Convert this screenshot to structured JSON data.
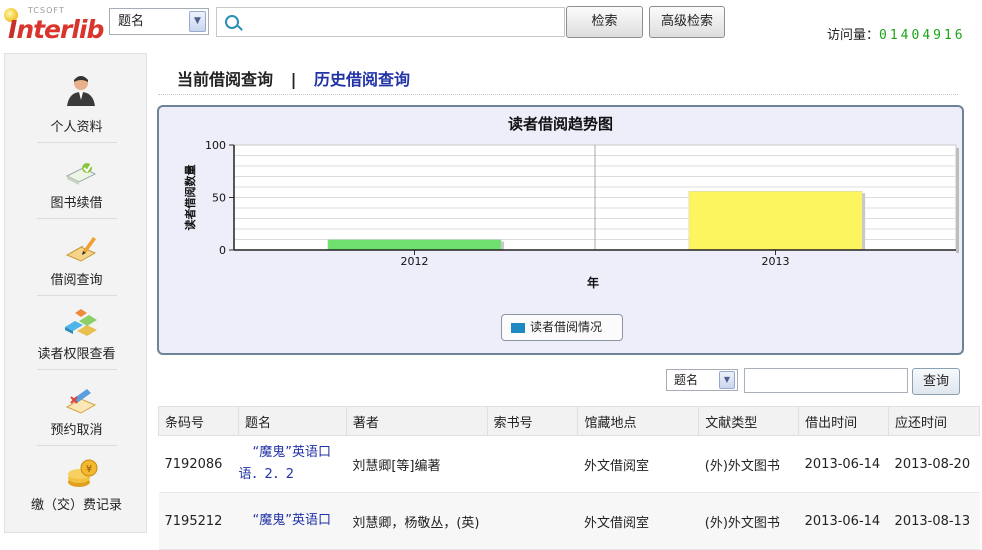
{
  "header": {
    "logo_small": "TCSOFT",
    "logo_main": "nterlib",
    "logo_prefix": "I",
    "search_field_select": "题名",
    "search_value": "",
    "search_button": "检索",
    "advanced_button": "高级检索",
    "visits_label": "访问量：",
    "visits_count": "01404916"
  },
  "sidebar": {
    "items": [
      {
        "label": "个人资料",
        "icon": "user-avatar-icon"
      },
      {
        "label": "图书续借",
        "icon": "book-renew-icon"
      },
      {
        "label": "借阅查询",
        "icon": "borrow-query-icon"
      },
      {
        "label": "读者权限查看",
        "icon": "reader-permission-icon"
      },
      {
        "label": "预约取消",
        "icon": "reservation-cancel-icon"
      },
      {
        "label": "缴（交）费记录",
        "icon": "fee-record-icon"
      }
    ]
  },
  "tabs": {
    "current": "当前借阅查询",
    "separator": "|",
    "history": "历史借阅查询"
  },
  "chart_data": {
    "type": "bar",
    "title": "读者借阅趋势图",
    "xlabel": "年",
    "ylabel": "读者借阅数量",
    "categories": [
      "2012",
      "2013"
    ],
    "series": [
      {
        "name": "读者借阅情况",
        "values": [
          10,
          56
        ]
      }
    ],
    "bar_colors": [
      "#6de06d",
      "#fdf560"
    ],
    "ylim": [
      0,
      100
    ],
    "yticks": [
      "0",
      "50",
      "100"
    ],
    "grid": true,
    "legend_position": "bottom-center",
    "legend_color": "#1f8ac2"
  },
  "filter": {
    "select": "题名",
    "input_value": "",
    "button": "查询"
  },
  "table": {
    "headers": [
      "条码号",
      "题名",
      "著者",
      "索书号",
      "馆藏地点",
      "文献类型",
      "借出时间",
      "应还时间"
    ],
    "rows": [
      {
        "barcode": "7192086",
        "title_line1": "“魔鬼”英语口",
        "title_line2": "语．2．2",
        "author": "刘慧卿[等]编著",
        "call_no": "",
        "location": "外文借阅室",
        "doc_type": "(外)外文图书",
        "borrow_date": "2013-06-14",
        "due_date": "2013-08-20"
      },
      {
        "barcode": "7195212",
        "title_line1": "“魔鬼”英语口",
        "title_line2": "",
        "author": "刘慧卿，杨敬丛，(英)",
        "call_no": "",
        "location": "外文借阅室",
        "doc_type": "(外)外文图书",
        "borrow_date": "2013-06-14",
        "due_date": "2013-08-13"
      }
    ]
  }
}
